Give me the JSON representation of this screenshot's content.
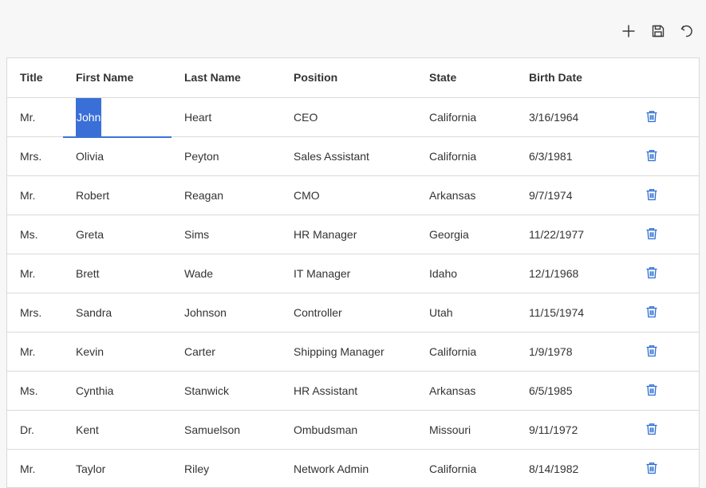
{
  "toolbar": {
    "add_icon": "plus-icon",
    "save_icon": "save-icon",
    "undo_icon": "undo-icon"
  },
  "colors": {
    "accent": "#3a6fd8",
    "delete_icon": "#2f6fd1",
    "border": "#d9d9d9"
  },
  "grid": {
    "columns": [
      "Title",
      "First Name",
      "Last Name",
      "Position",
      "State",
      "Birth Date"
    ],
    "rows": [
      {
        "title": "Mr.",
        "first": "John",
        "last": "Heart",
        "position": "CEO",
        "state": "California",
        "birth": "3/16/1964"
      },
      {
        "title": "Mrs.",
        "first": "Olivia",
        "last": "Peyton",
        "position": "Sales Assistant",
        "state": "California",
        "birth": "6/3/1981"
      },
      {
        "title": "Mr.",
        "first": "Robert",
        "last": "Reagan",
        "position": "CMO",
        "state": "Arkansas",
        "birth": "9/7/1974"
      },
      {
        "title": "Ms.",
        "first": "Greta",
        "last": "Sims",
        "position": "HR Manager",
        "state": "Georgia",
        "birth": "11/22/1977"
      },
      {
        "title": "Mr.",
        "first": "Brett",
        "last": "Wade",
        "position": "IT Manager",
        "state": "Idaho",
        "birth": "12/1/1968"
      },
      {
        "title": "Mrs.",
        "first": "Sandra",
        "last": "Johnson",
        "position": "Controller",
        "state": "Utah",
        "birth": "11/15/1974"
      },
      {
        "title": "Mr.",
        "first": "Kevin",
        "last": "Carter",
        "position": "Shipping Manager",
        "state": "California",
        "birth": "1/9/1978"
      },
      {
        "title": "Ms.",
        "first": "Cynthia",
        "last": "Stanwick",
        "position": "HR Assistant",
        "state": "Arkansas",
        "birth": "6/5/1985"
      },
      {
        "title": "Dr.",
        "first": "Kent",
        "last": "Samuelson",
        "position": "Ombudsman",
        "state": "Missouri",
        "birth": "9/11/1972"
      },
      {
        "title": "Mr.",
        "first": "Taylor",
        "last": "Riley",
        "position": "Network Admin",
        "state": "California",
        "birth": "8/14/1982"
      }
    ]
  }
}
